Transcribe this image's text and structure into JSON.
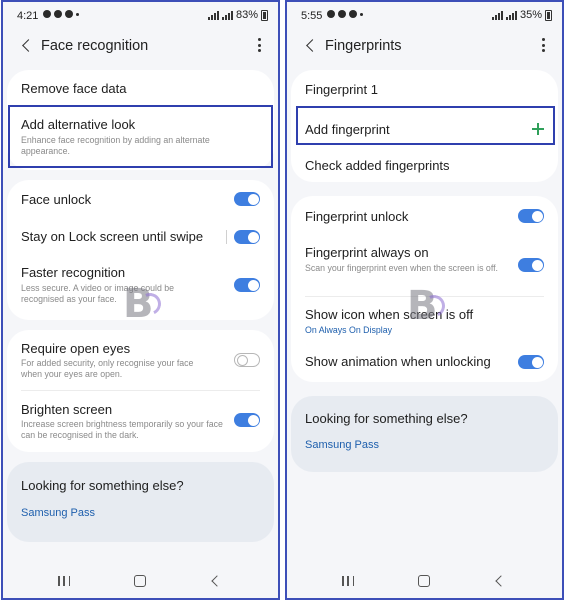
{
  "left": {
    "status": {
      "time": "4:21",
      "battery": "83%"
    },
    "header": {
      "title": "Face recognition"
    },
    "top_card": {
      "remove": "Remove face data",
      "alt_look_title": "Add alternative look",
      "alt_look_desc": "Enhance face recognition by adding an alternate appearance."
    },
    "settings": {
      "face_unlock": {
        "label": "Face unlock",
        "on": true
      },
      "stay_lock": {
        "label": "Stay on Lock screen until swipe",
        "on": true
      },
      "faster": {
        "label": "Faster recognition",
        "desc": "Less secure. A video or image could be recognised as your face.",
        "on": true
      }
    },
    "eyes": {
      "require": {
        "label": "Require open eyes",
        "desc": "For added security, only recognise your face when your eyes are open.",
        "on": false
      },
      "brighten": {
        "label": "Brighten screen",
        "desc": "Increase screen brightness temporarily so your face can be recognised in the dark.",
        "on": true
      }
    },
    "looking": {
      "title": "Looking for something else?",
      "link": "Samsung Pass"
    }
  },
  "right": {
    "status": {
      "time": "5:55",
      "battery": "35%"
    },
    "header": {
      "title": "Fingerprints"
    },
    "top_card": {
      "fp1": "Fingerprint 1",
      "add": "Add fingerprint",
      "check": "Check added fingerprints"
    },
    "settings": {
      "unlock": {
        "label": "Fingerprint unlock",
        "on": true
      },
      "always_on": {
        "label": "Fingerprint always on",
        "desc": "Scan your fingerprint even when the screen is off.",
        "on": true
      },
      "show_icon": {
        "label": "Show icon when screen is off",
        "desc": "On Always On Display"
      },
      "animation": {
        "label": "Show animation when unlocking",
        "on": true
      }
    },
    "looking": {
      "title": "Looking for something else?",
      "link": "Samsung Pass"
    }
  },
  "colors": {
    "accent": "#3e7ee0",
    "link": "#1e5fad",
    "highlight": "#2f3fae",
    "add_plus": "#2fa05a",
    "background": "#f5f6f9"
  },
  "icons": [
    "back-icon",
    "more-options-icon",
    "toggle-switch",
    "plus-icon",
    "recent-apps-icon",
    "home-icon",
    "nav-back-icon",
    "watermark-logo"
  ]
}
